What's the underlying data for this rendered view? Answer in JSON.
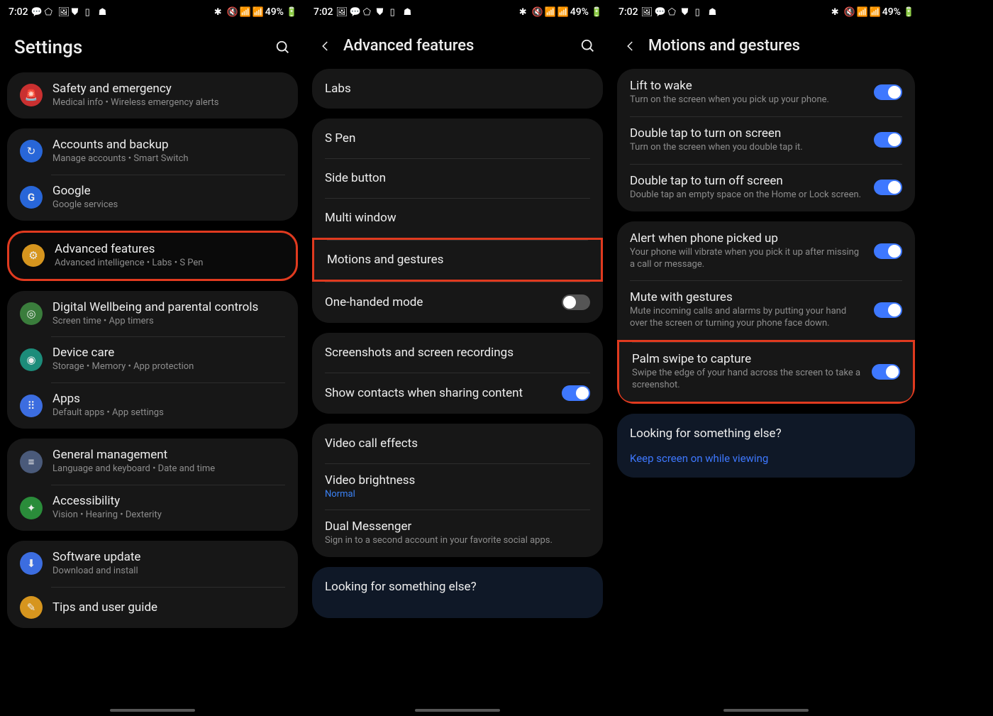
{
  "status": {
    "time": "7:02",
    "battery": "49%"
  },
  "screen1": {
    "title": "Settings",
    "items": [
      {
        "label": "Safety and emergency",
        "sub": "Medical info  •  Wireless emergency alerts"
      },
      {
        "label": "Accounts and backup",
        "sub": "Manage accounts  •  Smart Switch"
      },
      {
        "label": "Google",
        "sub": "Google services"
      },
      {
        "label": "Advanced features",
        "sub": "Advanced intelligence  •  Labs  •  S Pen"
      },
      {
        "label": "Digital Wellbeing and parental controls",
        "sub": "Screen time  •  App timers"
      },
      {
        "label": "Device care",
        "sub": "Storage  •  Memory  •  App protection"
      },
      {
        "label": "Apps",
        "sub": "Default apps  •  App settings"
      },
      {
        "label": "General management",
        "sub": "Language and keyboard  •  Date and time"
      },
      {
        "label": "Accessibility",
        "sub": "Vision  •  Hearing  •  Dexterity"
      },
      {
        "label": "Software update",
        "sub": "Download and install"
      },
      {
        "label": "Tips and user guide",
        "sub": ""
      }
    ]
  },
  "screen2": {
    "title": "Advanced features",
    "items": {
      "labs": "Labs",
      "spen": "S Pen",
      "side": "Side button",
      "multi": "Multi window",
      "motions": "Motions and gestures",
      "onehand": "One-handed mode",
      "screenshots": "Screenshots and screen recordings",
      "contacts": "Show contacts when sharing content",
      "videofx": "Video call effects",
      "videobright": "Video brightness",
      "videobright_val": "Normal",
      "dual": "Dual Messenger",
      "dual_sub": "Sign in to a second account in your favorite social apps."
    },
    "looking": "Looking for something else?"
  },
  "screen3": {
    "title": "Motions and gestures",
    "items": [
      {
        "label": "Lift to wake",
        "sub": "Turn on the screen when you pick up your phone."
      },
      {
        "label": "Double tap to turn on screen",
        "sub": "Turn on the screen when you double tap it."
      },
      {
        "label": "Double tap to turn off screen",
        "sub": "Double tap an empty space on the Home or Lock screen."
      },
      {
        "label": "Alert when phone picked up",
        "sub": "Your phone will vibrate when you pick it up after missing a call or message."
      },
      {
        "label": "Mute with gestures",
        "sub": "Mute incoming calls and alarms by putting your hand over the screen or turning your phone face down."
      },
      {
        "label": "Palm swipe to capture",
        "sub": "Swipe the edge of your hand across the screen to take a screenshot."
      }
    ],
    "looking": "Looking for something else?",
    "looking_link": "Keep screen on while viewing"
  }
}
